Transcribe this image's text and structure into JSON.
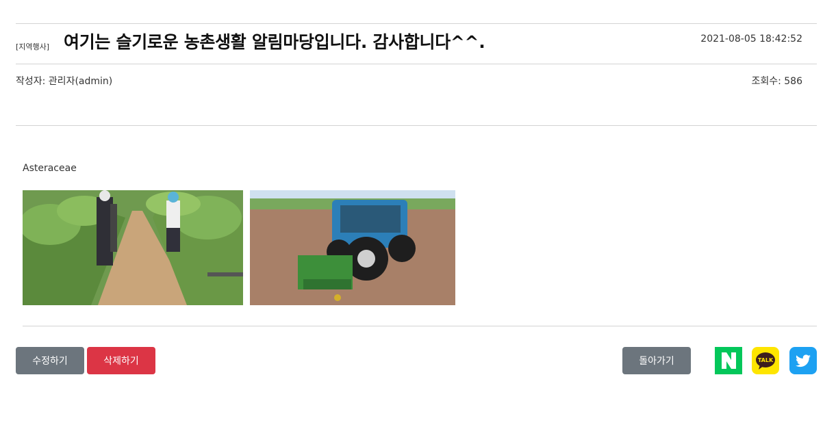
{
  "post": {
    "category": "[지역행사]",
    "title": "여기는 슬기로운 농촌생활 알림마당입니다. 감사합니다^^.",
    "date": "2021-08-05 18:42:52",
    "author": "작성자: 관리자(admin)",
    "views": "조회수: 586",
    "body_text": "Asteraceae"
  },
  "photos": [
    {
      "name": "orchard-workers-photo"
    },
    {
      "name": "tractor-field-photo"
    }
  ],
  "actions": {
    "edit_label": "수정하기",
    "delete_label": "삭제하기",
    "back_label": "돌아가기"
  },
  "share": {
    "naver_icon": "naver-icon",
    "kakao_icon": "kakaotalk-icon",
    "kakao_text": "TALK",
    "twitter_icon": "twitter-icon"
  },
  "colors": {
    "secondary": "#6c757d",
    "danger": "#dc3545",
    "naver": "#03c75a",
    "kakao": "#fee500",
    "twitter": "#1da1f2"
  }
}
